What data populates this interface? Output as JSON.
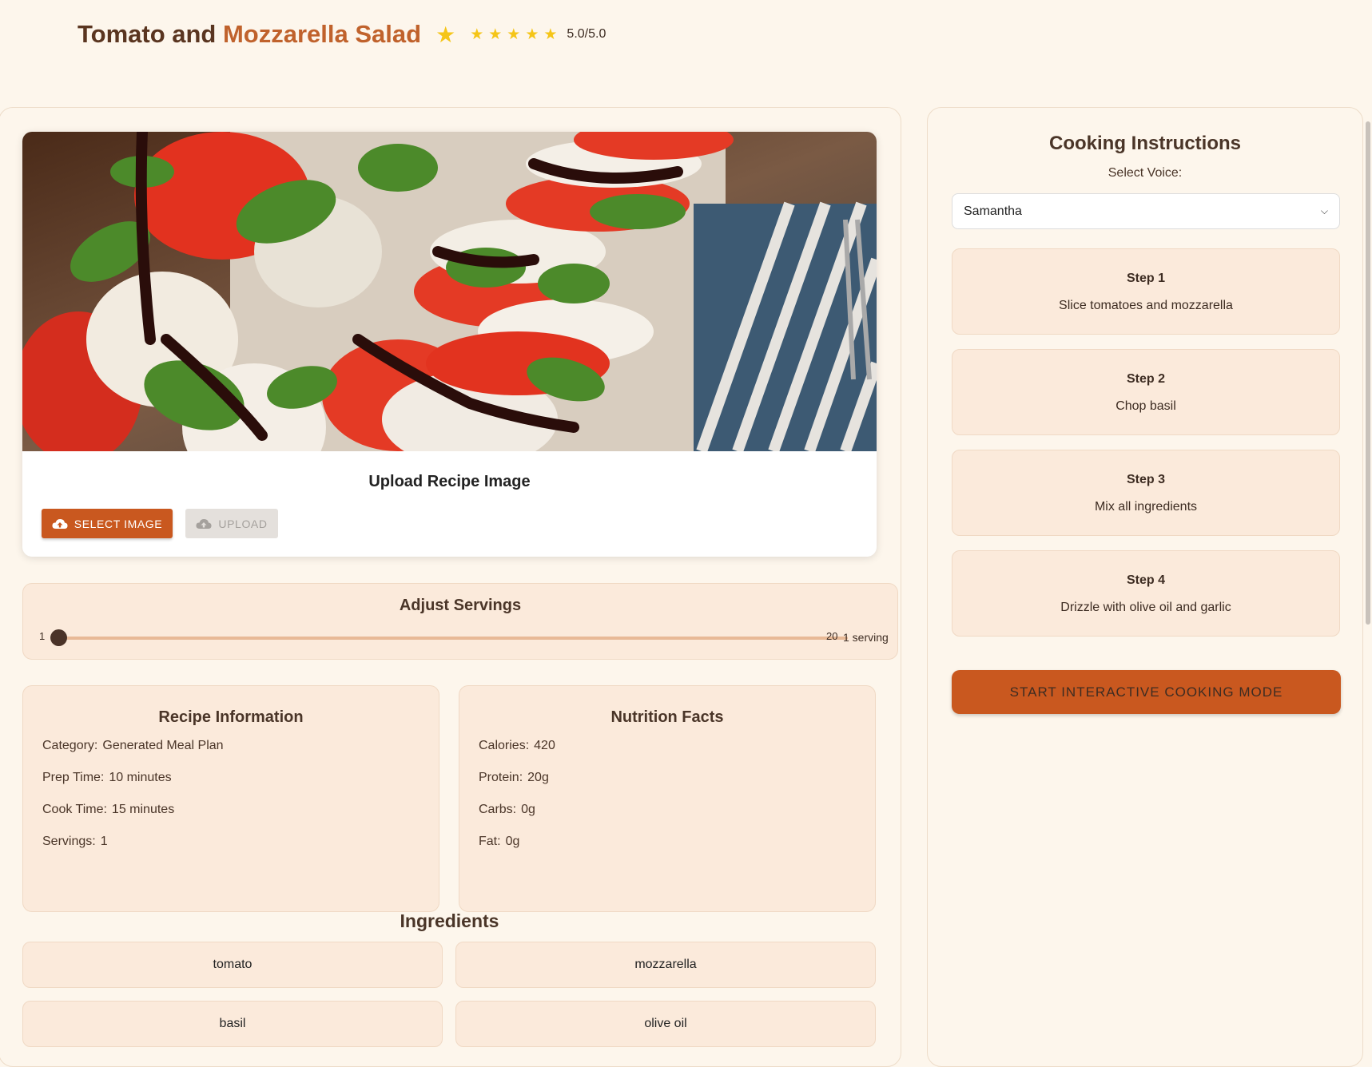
{
  "header": {
    "title_part1": "Tomato and ",
    "title_part2": "Mozzarella Salad",
    "rating_text": "5.0/5.0",
    "rating_value": 5.0,
    "rating_max": 5
  },
  "image_upload": {
    "title": "Upload Recipe Image",
    "select_label": "SELECT IMAGE",
    "upload_label": "UPLOAD"
  },
  "servings": {
    "title": "Adjust Servings",
    "min": "1",
    "max": "20",
    "value": 1,
    "value_label": "1 serving"
  },
  "recipe_info": {
    "title": "Recipe Information",
    "rows": [
      {
        "key": "Category:",
        "value": "Generated Meal Plan"
      },
      {
        "key": "Prep Time:",
        "value": "10 minutes"
      },
      {
        "key": "Cook Time:",
        "value": "15 minutes"
      },
      {
        "key": "Servings:",
        "value": "1"
      }
    ]
  },
  "nutrition": {
    "title": "Nutrition Facts",
    "rows": [
      {
        "key": "Calories:",
        "value": "420"
      },
      {
        "key": "Protein:",
        "value": "20g"
      },
      {
        "key": "Carbs:",
        "value": "0g"
      },
      {
        "key": "Fat:",
        "value": "0g"
      }
    ]
  },
  "ingredients": {
    "title": "Ingredients",
    "items": [
      "tomato",
      "mozzarella",
      "basil",
      "olive oil"
    ]
  },
  "instructions": {
    "title": "Cooking Instructions",
    "voice_label": "Select Voice:",
    "voice_selected": "Samantha",
    "steps": [
      {
        "title": "Step 1",
        "text": "Slice tomatoes and mozzarella"
      },
      {
        "title": "Step 2",
        "text": "Chop basil"
      },
      {
        "title": "Step 3",
        "text": "Mix all ingredients"
      },
      {
        "title": "Step 4",
        "text": "Drizzle with olive oil and garlic"
      }
    ],
    "cook_mode_label": "START INTERACTIVE COOKING MODE"
  },
  "colors": {
    "accent": "#c9581f",
    "background": "#fdf6ec",
    "card": "#fbeadb",
    "star": "#f5c518"
  }
}
